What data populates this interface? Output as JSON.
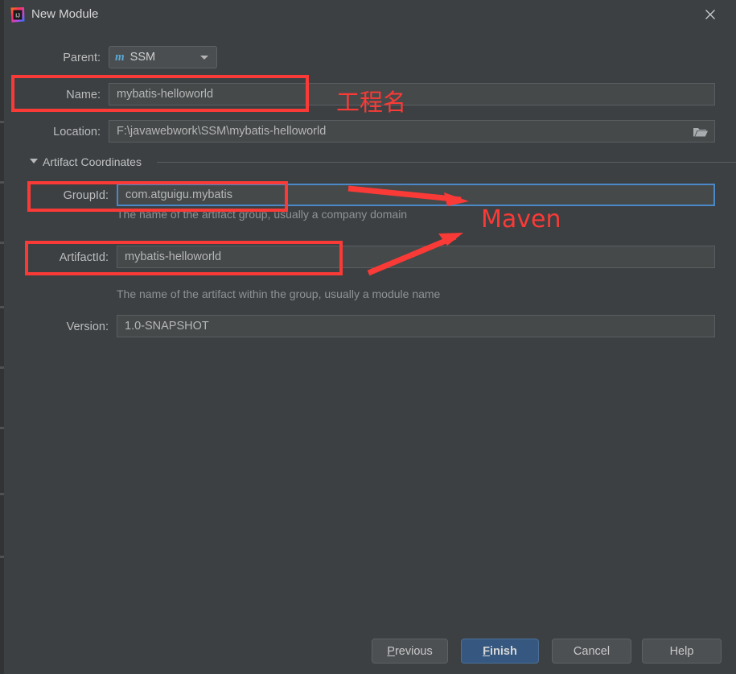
{
  "window": {
    "title": "New Module",
    "app_icon": "intellij-idea-icon",
    "close_label": "✕",
    "bg_color": "#3c4043"
  },
  "form": {
    "parent": {
      "label": "Parent:",
      "value": "SSM",
      "icon": "maven-m-icon",
      "icon_color": "#5ca7d4"
    },
    "name": {
      "label": "Name:",
      "value": "mybatis-helloworld"
    },
    "location": {
      "label": "Location:",
      "value": "F:\\javawebwork\\SSM\\mybatis-helloworld",
      "browse_icon": "folder-icon"
    },
    "section": {
      "label": "Artifact Coordinates",
      "expanded": true,
      "chevron_icon": "chevron-down-icon"
    },
    "group_id": {
      "label": "GroupId:",
      "value": "com.atguigu.mybatis",
      "hint": "The name of the artifact group, usually a company domain",
      "focused": true,
      "focus_color": "#4a88c7"
    },
    "artifact_id": {
      "label": "ArtifactId:",
      "value": "mybatis-helloworld",
      "hint": "The name of the artifact within the group, usually a module name"
    },
    "version": {
      "label": "Version:",
      "value": "1.0-SNAPSHOT"
    }
  },
  "buttons": {
    "previous": {
      "label": "Previous",
      "mnemonic": "P"
    },
    "finish": {
      "label": "Finish",
      "mnemonic": "F",
      "primary": true,
      "color": "#365880"
    },
    "cancel": {
      "label": "Cancel"
    },
    "help": {
      "label": "Help"
    }
  },
  "annotations": {
    "color": "#fa3a36",
    "label_project_name": "工程名",
    "label_maven": "Maven",
    "boxes": [
      "name-field-row",
      "group-id-row",
      "artifact-id-row"
    ],
    "arrows": [
      "arrow-to-groupid-row",
      "arrow-to-artifactid-row"
    ]
  }
}
